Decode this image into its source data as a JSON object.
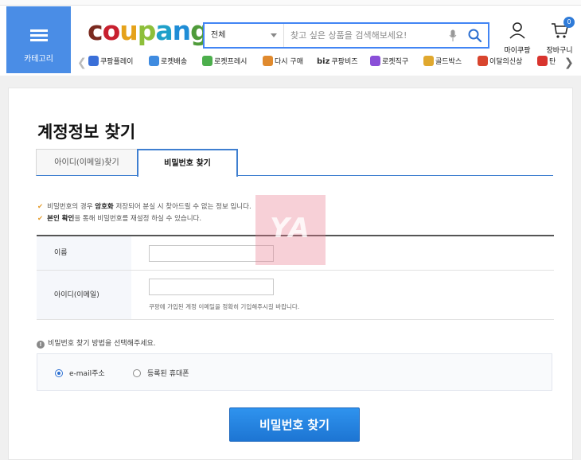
{
  "header": {
    "category_label": "카테고리",
    "logo_letters": [
      {
        "ch": "c",
        "color": "#7a2a1f"
      },
      {
        "ch": "o",
        "color": "#c8202f"
      },
      {
        "ch": "u",
        "color": "#e5a21a"
      },
      {
        "ch": "p",
        "color": "#8dbf3a"
      },
      {
        "ch": "a",
        "color": "#1fa0c9"
      },
      {
        "ch": "n",
        "color": "#1f8dd6"
      },
      {
        "ch": "g",
        "color": "#4f9b3a"
      }
    ],
    "search": {
      "category": "전체",
      "placeholder": "찾고 싶은 상품을 검색해보세요!"
    },
    "mycoupang_label": "마이쿠팡",
    "cart_label": "장바구니",
    "cart_count": "0"
  },
  "quicklinks": [
    {
      "label": "쿠팡플레이",
      "icon": "play-icon",
      "color": "#3a6fd8"
    },
    {
      "label": "로켓배송",
      "icon": "rocket-icon",
      "color": "#3f8be0"
    },
    {
      "label": "로켓프레시",
      "icon": "rocket-fresh-icon",
      "color": "#4cae4c"
    },
    {
      "label": "다시 구매",
      "icon": "house-icon",
      "color": "#e08a2e"
    },
    {
      "label": "쿠팡비즈",
      "prefix": "biz",
      "icon": "biz-icon",
      "color": "#333333"
    },
    {
      "label": "로켓직구",
      "icon": "globe-icon",
      "color": "#8a4fd8"
    },
    {
      "label": "골드박스",
      "icon": "gift-icon",
      "color": "#e0a82e"
    },
    {
      "label": "이달의신상",
      "icon": "new-icon",
      "color": "#d8452e"
    },
    {
      "label": "탄",
      "icon": "percent-icon",
      "color": "#d8342e"
    }
  ],
  "page": {
    "title": "계정정보 찾기",
    "tabs": [
      {
        "label": "아이디(이메일)찾기",
        "active": false
      },
      {
        "label": "비밀번호 찾기",
        "active": true
      }
    ],
    "notices": [
      {
        "pre": "비밀번호의 경우 ",
        "bold": "암호화",
        "post": " 저장되어 분실 시 찾아드릴 수 없는 정보 입니다."
      },
      {
        "pre": "",
        "bold": "본인 확인",
        "post": "을 통해 비밀번호를 재설정 하실 수 있습니다."
      }
    ],
    "form": {
      "name_label": "이름",
      "name_value": "",
      "id_label": "아이디(이메일)",
      "id_value": "",
      "id_hint": "쿠팡에 가입된 계정 이메일을 정확히 기입해주시길 바랍니다."
    },
    "method_prompt": "비밀번호 찾기 방법을 선택해주세요.",
    "methods": [
      {
        "label": "e-mail주소",
        "selected": true
      },
      {
        "label": "등록된 휴대폰",
        "selected": false
      }
    ],
    "submit_label": "비밀번호 찾기",
    "watermark_text": "YA"
  }
}
